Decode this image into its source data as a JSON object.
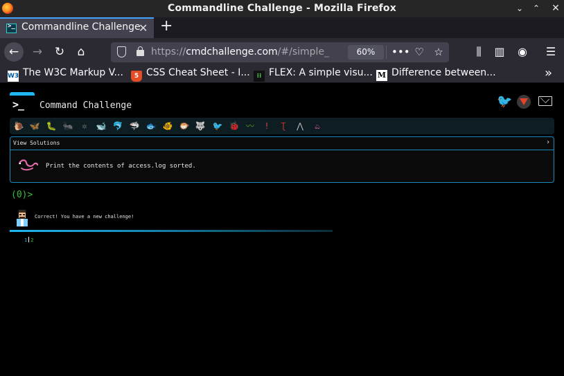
{
  "window": {
    "title": "Commandline Challenge - Mozilla Firefox"
  },
  "tab": {
    "title": "Commandline Challenge"
  },
  "urlbar": {
    "scheme": "https://",
    "host": "cmdchallenge.com",
    "path": "/#/simple_",
    "zoom": "60%"
  },
  "bookmarks": [
    {
      "label": "The W3C Markup V...",
      "icon": "w3c-icon"
    },
    {
      "label": "CSS Cheat Sheet - I...",
      "icon": "html5-icon"
    },
    {
      "label": "FLEX: A simple visu...",
      "icon": "flex-icon"
    },
    {
      "label": "Difference between...",
      "icon": "medium-icon"
    }
  ],
  "site": {
    "title": "Command Challenge",
    "panel_label": "View Solutions",
    "task": "Print the contents of access.log sorted.",
    "prompt": "(0)>",
    "message": "Correct! You have a new challenge!",
    "level_done": "1",
    "level_current": "2"
  },
  "challenge_icons": [
    "snail-icon",
    "butterfly-icon",
    "caterpillar-icon",
    "ant-icon",
    "spider-icon",
    "whale-icon",
    "dolphin-icon",
    "shark-icon",
    "fish-icon",
    "tropical-fish-icon",
    "puffer-fish-icon",
    "wolf-icon",
    "bird-icon",
    "ladybug-icon",
    "worm-icon",
    "candle-icon",
    "crane-fly-icon",
    "moth-icon",
    "snake-icon"
  ],
  "colors": {
    "accent": "#1fb7f0",
    "prompt_green": "#35c135",
    "panel_border": "#1a8ab8"
  }
}
